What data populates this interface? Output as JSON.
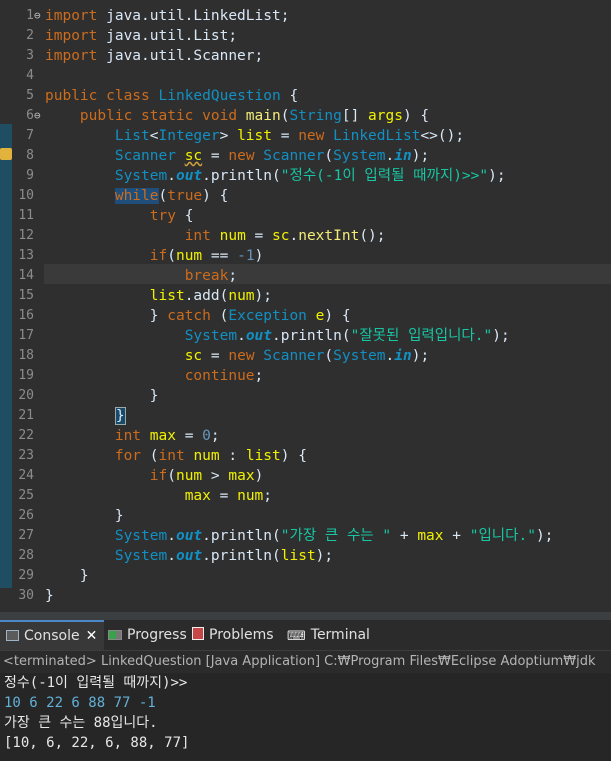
{
  "editor": {
    "lines": [
      {
        "n": "1",
        "segs": [
          {
            "t": "import ",
            "c": "kw"
          },
          {
            "t": "java.util.LinkedList;",
            "c": "pl"
          }
        ]
      },
      {
        "n": "2",
        "segs": [
          {
            "t": "import ",
            "c": "kw"
          },
          {
            "t": "java.util.List;",
            "c": "pl"
          }
        ]
      },
      {
        "n": "3",
        "segs": [
          {
            "t": "import ",
            "c": "kw"
          },
          {
            "t": "java.util.Scanner;",
            "c": "pl"
          }
        ]
      },
      {
        "n": "4",
        "segs": []
      },
      {
        "n": "5",
        "segs": [
          {
            "t": "public class ",
            "c": "kw"
          },
          {
            "t": "LinkedQuestion",
            "c": "ty"
          },
          {
            "t": " {",
            "c": "pl"
          }
        ]
      },
      {
        "n": "6",
        "segs": [
          {
            "t": "    public static void ",
            "c": "kw"
          },
          {
            "t": "main",
            "c": "id"
          },
          {
            "t": "(",
            "c": "pl"
          },
          {
            "t": "String",
            "c": "ty"
          },
          {
            "t": "[] ",
            "c": "pl"
          },
          {
            "t": "args",
            "c": "var"
          },
          {
            "t": ") {",
            "c": "pl"
          }
        ]
      },
      {
        "n": "7",
        "segs": [
          {
            "t": "        ",
            "c": "pl"
          },
          {
            "t": "List",
            "c": "ty"
          },
          {
            "t": "<",
            "c": "pl"
          },
          {
            "t": "Integer",
            "c": "ty"
          },
          {
            "t": "> ",
            "c": "pl"
          },
          {
            "t": "list",
            "c": "var"
          },
          {
            "t": " = ",
            "c": "pl"
          },
          {
            "t": "new ",
            "c": "kw"
          },
          {
            "t": "LinkedList",
            "c": "ty"
          },
          {
            "t": "<>();",
            "c": "pl"
          }
        ]
      },
      {
        "n": "8",
        "segs": [
          {
            "t": "        ",
            "c": "pl"
          },
          {
            "t": "Scanner",
            "c": "ty"
          },
          {
            "t": " ",
            "c": "pl"
          },
          {
            "t": "sc",
            "c": "var und"
          },
          {
            "t": " = ",
            "c": "pl"
          },
          {
            "t": "new ",
            "c": "kw"
          },
          {
            "t": "Scanner",
            "c": "ty"
          },
          {
            "t": "(",
            "c": "pl"
          },
          {
            "t": "System",
            "c": "ty"
          },
          {
            "t": ".",
            "c": "pl"
          },
          {
            "t": "in",
            "c": "st"
          },
          {
            "t": ");",
            "c": "pl"
          }
        ]
      },
      {
        "n": "9",
        "segs": [
          {
            "t": "        ",
            "c": "pl"
          },
          {
            "t": "System",
            "c": "ty"
          },
          {
            "t": ".",
            "c": "pl"
          },
          {
            "t": "out",
            "c": "st"
          },
          {
            "t": ".println(",
            "c": "pl"
          },
          {
            "t": "\"정수(-1이 입력될 때까지)>>\"",
            "c": "str"
          },
          {
            "t": ");",
            "c": "pl"
          }
        ]
      },
      {
        "n": "10",
        "segs": [
          {
            "t": "        ",
            "c": "pl"
          },
          {
            "t": "while",
            "c": "kw sel"
          },
          {
            "t": "(",
            "c": "pl"
          },
          {
            "t": "true",
            "c": "kw"
          },
          {
            "t": ") {",
            "c": "pl"
          }
        ]
      },
      {
        "n": "11",
        "segs": [
          {
            "t": "            ",
            "c": "pl"
          },
          {
            "t": "try",
            "c": "kw"
          },
          {
            "t": " {",
            "c": "pl"
          }
        ]
      },
      {
        "n": "12",
        "segs": [
          {
            "t": "                ",
            "c": "pl"
          },
          {
            "t": "int ",
            "c": "kw"
          },
          {
            "t": "num",
            "c": "var"
          },
          {
            "t": " = ",
            "c": "pl"
          },
          {
            "t": "sc",
            "c": "var"
          },
          {
            "t": ".",
            "c": "pl"
          },
          {
            "t": "nextInt",
            "c": "id"
          },
          {
            "t": "();",
            "c": "pl"
          }
        ]
      },
      {
        "n": "13",
        "segs": [
          {
            "t": "            ",
            "c": "pl"
          },
          {
            "t": "if",
            "c": "kw"
          },
          {
            "t": "(",
            "c": "pl"
          },
          {
            "t": "num",
            "c": "var"
          },
          {
            "t": " == ",
            "c": "pl"
          },
          {
            "t": "-1",
            "c": "num"
          },
          {
            "t": ")",
            "c": "pl"
          }
        ]
      },
      {
        "n": "14",
        "segs": [
          {
            "t": "                ",
            "c": "pl"
          },
          {
            "t": "break",
            "c": "kw"
          },
          {
            "t": ";",
            "c": "pl"
          }
        ]
      },
      {
        "n": "15",
        "segs": [
          {
            "t": "            ",
            "c": "pl"
          },
          {
            "t": "list",
            "c": "var"
          },
          {
            "t": ".add(",
            "c": "pl"
          },
          {
            "t": "num",
            "c": "var"
          },
          {
            "t": ");",
            "c": "pl"
          }
        ]
      },
      {
        "n": "16",
        "segs": [
          {
            "t": "            } ",
            "c": "pl"
          },
          {
            "t": "catch",
            "c": "kw"
          },
          {
            "t": " (",
            "c": "pl"
          },
          {
            "t": "Exception",
            "c": "ty"
          },
          {
            "t": " ",
            "c": "pl"
          },
          {
            "t": "e",
            "c": "var"
          },
          {
            "t": ") {",
            "c": "pl"
          }
        ]
      },
      {
        "n": "17",
        "segs": [
          {
            "t": "                ",
            "c": "pl"
          },
          {
            "t": "System",
            "c": "ty"
          },
          {
            "t": ".",
            "c": "pl"
          },
          {
            "t": "out",
            "c": "st"
          },
          {
            "t": ".println(",
            "c": "pl"
          },
          {
            "t": "\"잘못된 입력입니다.\"",
            "c": "str"
          },
          {
            "t": ");",
            "c": "pl"
          }
        ]
      },
      {
        "n": "18",
        "segs": [
          {
            "t": "                ",
            "c": "pl"
          },
          {
            "t": "sc",
            "c": "var"
          },
          {
            "t": " = ",
            "c": "pl"
          },
          {
            "t": "new ",
            "c": "kw"
          },
          {
            "t": "Scanner",
            "c": "ty"
          },
          {
            "t": "(",
            "c": "pl"
          },
          {
            "t": "System",
            "c": "ty"
          },
          {
            "t": ".",
            "c": "pl"
          },
          {
            "t": "in",
            "c": "st"
          },
          {
            "t": ");",
            "c": "pl"
          }
        ]
      },
      {
        "n": "19",
        "segs": [
          {
            "t": "                ",
            "c": "pl"
          },
          {
            "t": "continue",
            "c": "kw"
          },
          {
            "t": ";",
            "c": "pl"
          }
        ]
      },
      {
        "n": "20",
        "segs": [
          {
            "t": "            }",
            "c": "pl"
          }
        ]
      },
      {
        "n": "21",
        "segs": [
          {
            "t": "        ",
            "c": "pl"
          },
          {
            "t": "}",
            "c": "pl brk"
          }
        ]
      },
      {
        "n": "22",
        "segs": [
          {
            "t": "        ",
            "c": "pl"
          },
          {
            "t": "int ",
            "c": "kw"
          },
          {
            "t": "max",
            "c": "var"
          },
          {
            "t": " = ",
            "c": "pl"
          },
          {
            "t": "0",
            "c": "num"
          },
          {
            "t": ";",
            "c": "pl"
          }
        ]
      },
      {
        "n": "23",
        "segs": [
          {
            "t": "        ",
            "c": "pl"
          },
          {
            "t": "for",
            "c": "kw"
          },
          {
            "t": " (",
            "c": "pl"
          },
          {
            "t": "int ",
            "c": "kw"
          },
          {
            "t": "num",
            "c": "var"
          },
          {
            "t": " : ",
            "c": "pl"
          },
          {
            "t": "list",
            "c": "var"
          },
          {
            "t": ") {",
            "c": "pl"
          }
        ]
      },
      {
        "n": "24",
        "segs": [
          {
            "t": "            ",
            "c": "pl"
          },
          {
            "t": "if",
            "c": "kw"
          },
          {
            "t": "(",
            "c": "pl"
          },
          {
            "t": "num",
            "c": "var"
          },
          {
            "t": " > ",
            "c": "pl"
          },
          {
            "t": "max",
            "c": "var"
          },
          {
            "t": ")",
            "c": "pl"
          }
        ]
      },
      {
        "n": "25",
        "segs": [
          {
            "t": "                ",
            "c": "pl"
          },
          {
            "t": "max",
            "c": "var"
          },
          {
            "t": " = ",
            "c": "pl"
          },
          {
            "t": "num",
            "c": "var"
          },
          {
            "t": ";",
            "c": "pl"
          }
        ]
      },
      {
        "n": "26",
        "segs": [
          {
            "t": "        }",
            "c": "pl"
          }
        ]
      },
      {
        "n": "27",
        "segs": [
          {
            "t": "        ",
            "c": "pl"
          },
          {
            "t": "System",
            "c": "ty"
          },
          {
            "t": ".",
            "c": "pl"
          },
          {
            "t": "out",
            "c": "st"
          },
          {
            "t": ".println(",
            "c": "pl"
          },
          {
            "t": "\"가장 큰 수는 \"",
            "c": "str"
          },
          {
            "t": " + ",
            "c": "pl"
          },
          {
            "t": "max",
            "c": "var"
          },
          {
            "t": " + ",
            "c": "pl"
          },
          {
            "t": "\"입니다.\"",
            "c": "str"
          },
          {
            "t": ");",
            "c": "pl"
          }
        ]
      },
      {
        "n": "28",
        "segs": [
          {
            "t": "        ",
            "c": "pl"
          },
          {
            "t": "System",
            "c": "ty"
          },
          {
            "t": ".",
            "c": "pl"
          },
          {
            "t": "out",
            "c": "st"
          },
          {
            "t": ".println(",
            "c": "pl"
          },
          {
            "t": "list",
            "c": "var"
          },
          {
            "t": ");",
            "c": "pl"
          }
        ]
      },
      {
        "n": "29",
        "segs": [
          {
            "t": "    }",
            "c": "pl"
          }
        ]
      },
      {
        "n": "30",
        "segs": [
          {
            "t": "}",
            "c": "pl"
          }
        ]
      }
    ],
    "fold_marker": "⊖"
  },
  "tabs": {
    "console": "Console",
    "console_close": "✕",
    "progress": "Progress",
    "problems": "Problems",
    "terminal": "Terminal",
    "terminal_icon": "⌨"
  },
  "console": {
    "status": "<terminated> LinkedQuestion [Java Application] C:₩Program Files₩Eclipse Adoptium₩jdk",
    "prompt": "정수(-1이 입력될 때까지)>>",
    "input": "10 6 22 6 88 77 -1",
    "result": "가장 큰 수는 88입니다.",
    "list": "[10, 6, 22, 6, 88, 77]"
  }
}
